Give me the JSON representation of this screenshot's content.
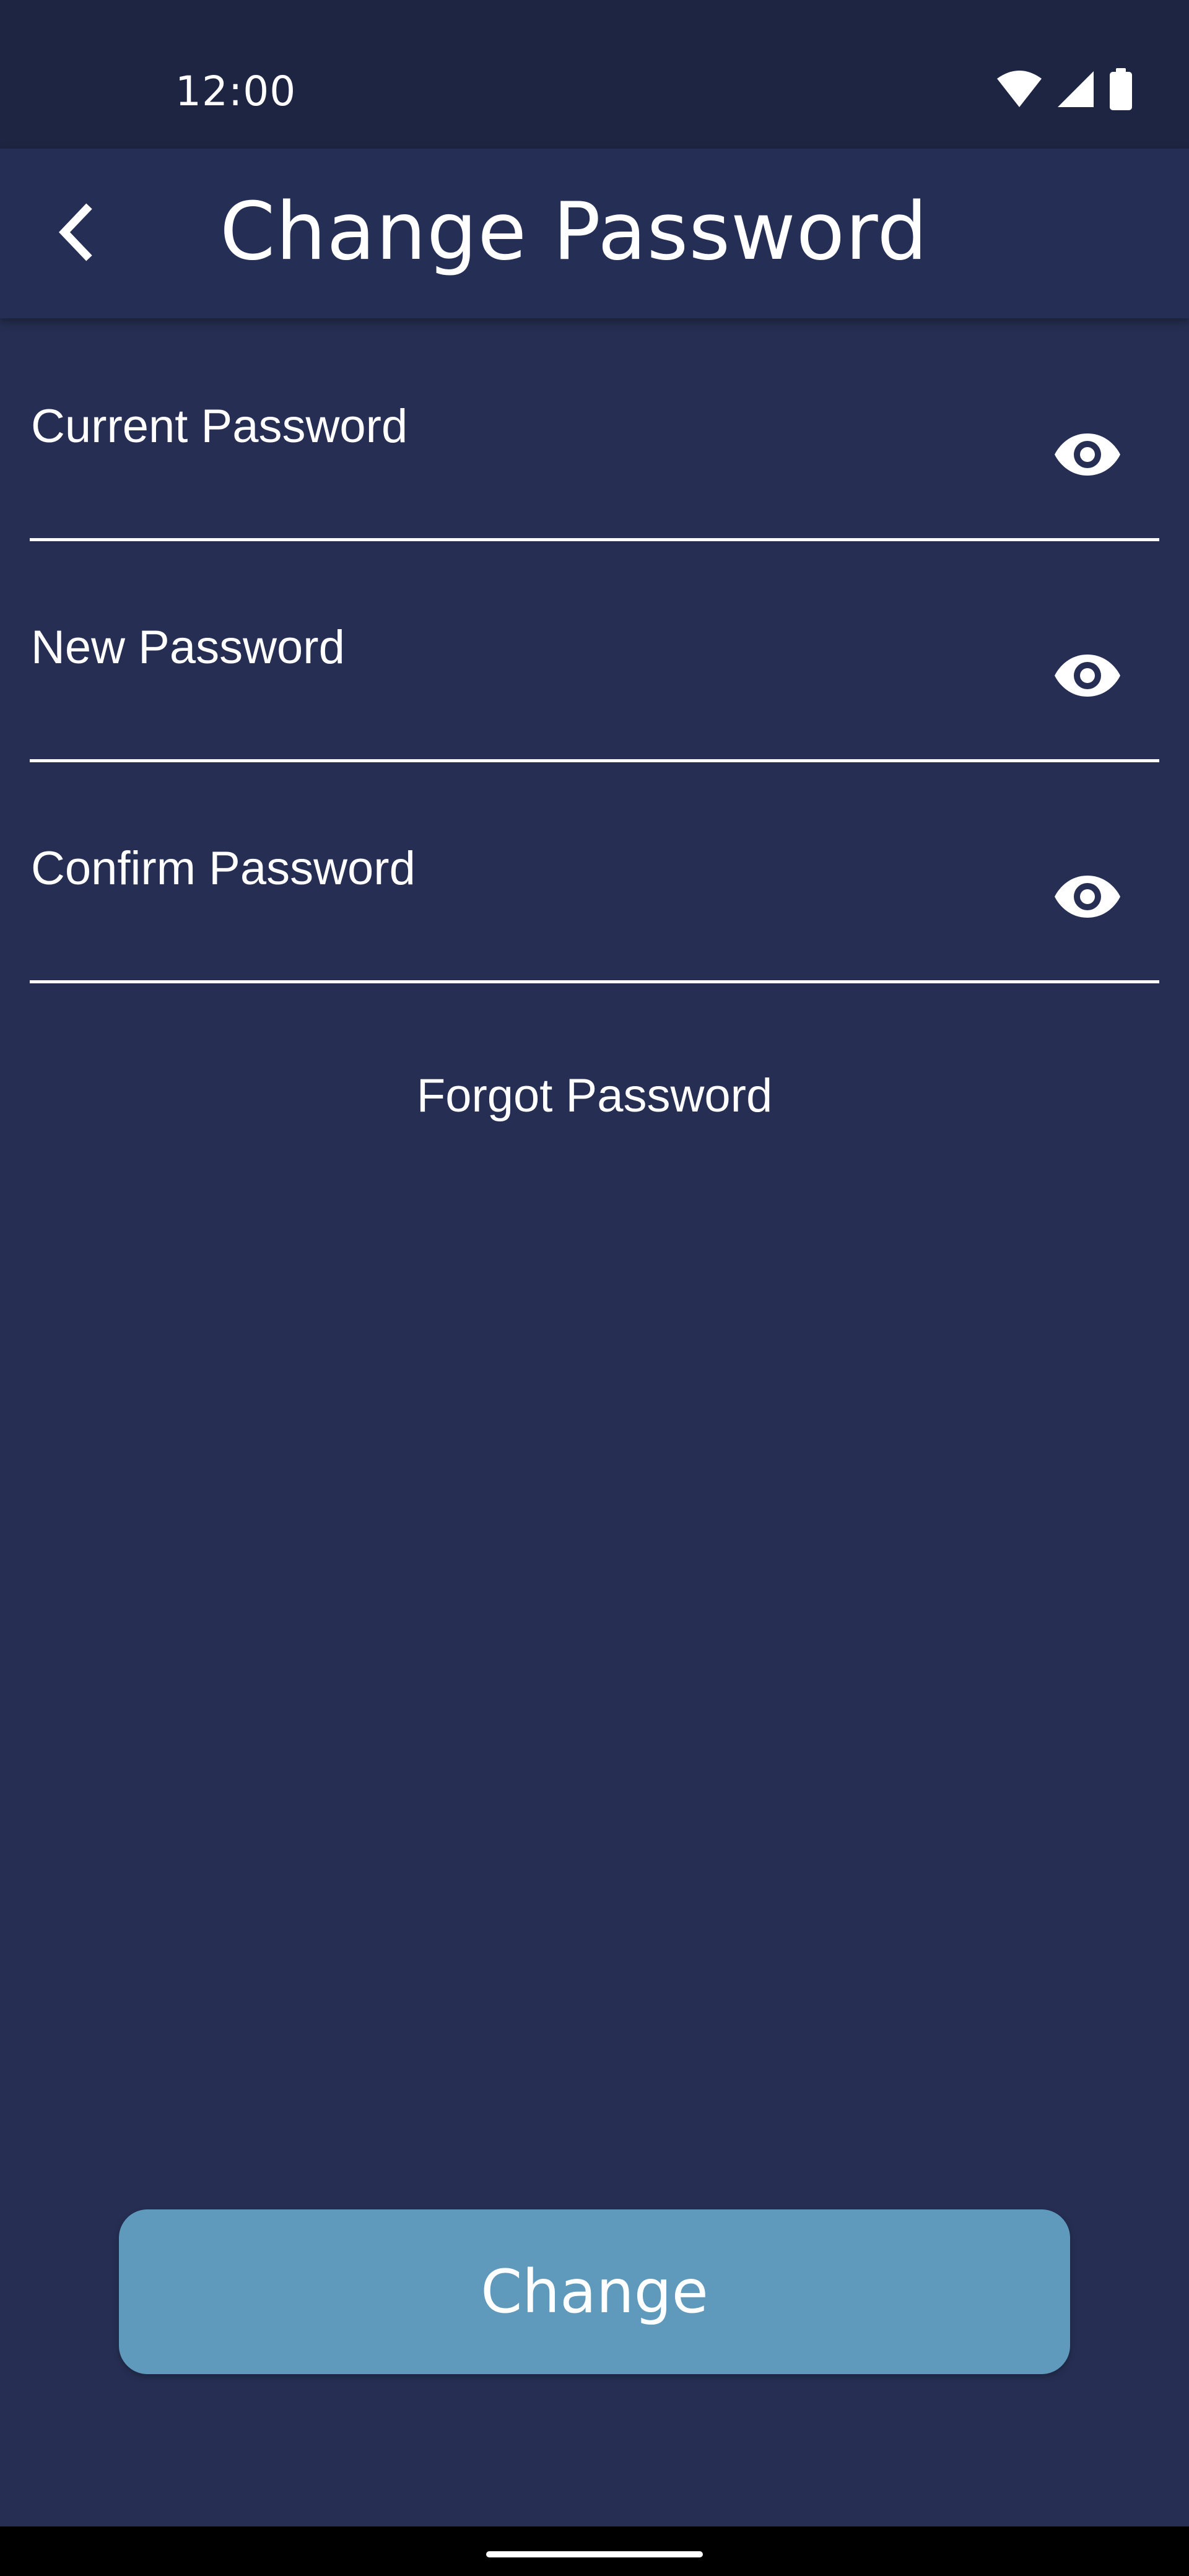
{
  "status_bar": {
    "time": "12:00",
    "icons": [
      "wifi-icon",
      "cellular-signal-icon",
      "battery-icon"
    ]
  },
  "app_bar": {
    "back_icon": "chevron-left-icon",
    "title": "Change Password"
  },
  "form": {
    "fields": [
      {
        "name": "current-password",
        "placeholder": "Current Password",
        "value": "",
        "toggle_icon": "eye-icon"
      },
      {
        "name": "new-password",
        "placeholder": "New Password",
        "value": "",
        "toggle_icon": "eye-icon"
      },
      {
        "name": "confirm-password",
        "placeholder": "Confirm Password",
        "value": "",
        "toggle_icon": "eye-icon"
      }
    ],
    "forgot_password_label": "Forgot Password",
    "submit_label": "Change"
  },
  "colors": {
    "background": "#262f53",
    "status_bar": "#1e2542",
    "app_bar": "#252f55",
    "button": "#5f9abd",
    "text": "#ffffff"
  }
}
